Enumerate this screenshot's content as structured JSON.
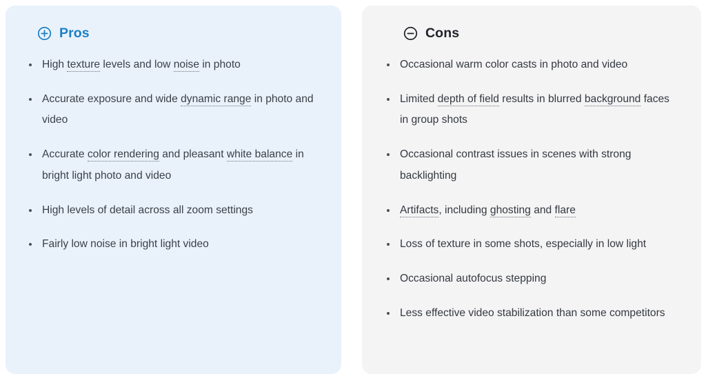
{
  "pros": {
    "title": "Pros",
    "icon": "plus-circle-icon",
    "accent_color": "#1b7fc4",
    "background_color": "#e9f2fb",
    "items": [
      [
        {
          "text": "High ",
          "term": false
        },
        {
          "text": "texture",
          "term": true
        },
        {
          "text": " levels and low ",
          "term": false
        },
        {
          "text": "noise",
          "term": true
        },
        {
          "text": " in photo",
          "term": false
        }
      ],
      [
        {
          "text": "Accurate exposure and wide ",
          "term": false
        },
        {
          "text": "dynamic range",
          "term": true
        },
        {
          "text": " in photo and video",
          "term": false
        }
      ],
      [
        {
          "text": "Accurate ",
          "term": false
        },
        {
          "text": "color rendering",
          "term": true
        },
        {
          "text": " and pleasant ",
          "term": false
        },
        {
          "text": "white balance",
          "term": true
        },
        {
          "text": " in bright light photo and video",
          "term": false
        }
      ],
      [
        {
          "text": "High levels of detail across all zoom settings",
          "term": false
        }
      ],
      [
        {
          "text": "Fairly low noise in bright light video",
          "term": false
        }
      ]
    ]
  },
  "cons": {
    "title": "Cons",
    "icon": "minus-circle-icon",
    "accent_color": "#1f2228",
    "background_color": "#f4f4f5",
    "items": [
      [
        {
          "text": "Occasional warm color casts in photo and video",
          "term": false
        }
      ],
      [
        {
          "text": "Limited ",
          "term": false
        },
        {
          "text": "depth of field",
          "term": true
        },
        {
          "text": " results in blurred ",
          "term": false
        },
        {
          "text": "background",
          "term": true
        },
        {
          "text": " faces in group shots",
          "term": false
        }
      ],
      [
        {
          "text": "Occasional contrast issues in scenes with strong backlighting",
          "term": false
        }
      ],
      [
        {
          "text": "Artifacts",
          "term": true
        },
        {
          "text": ", including ",
          "term": false
        },
        {
          "text": "ghosting",
          "term": true
        },
        {
          "text": " and ",
          "term": false
        },
        {
          "text": "flare",
          "term": true
        }
      ],
      [
        {
          "text": "Loss of texture in some shots, especially in low light",
          "term": false
        }
      ],
      [
        {
          "text": "Occasional autofocus stepping",
          "term": false
        }
      ],
      [
        {
          "text": "Less effective video stabilization than some competitors",
          "term": false
        }
      ]
    ]
  }
}
